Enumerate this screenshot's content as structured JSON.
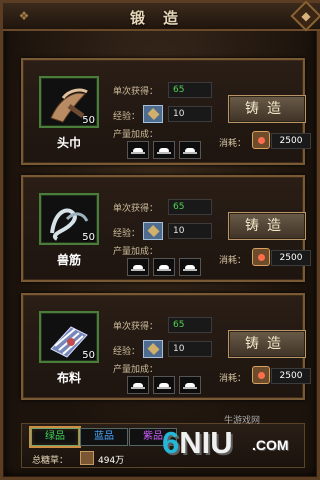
{
  "header": {
    "title": "锻造",
    "close_icon": "close-icon"
  },
  "items": [
    {
      "name": "头巾",
      "level": "50",
      "yield_label": "单次获得：",
      "yield_value": "65",
      "exp_label": "经验：",
      "exp_value": "10",
      "bonus_label": "产量加成：",
      "button_label": "铸造",
      "cost_label": "消耗：",
      "cost_value": "2500",
      "icon": "headscarf-icon"
    },
    {
      "name": "兽筋",
      "level": "50",
      "yield_label": "单次获得：",
      "yield_value": "65",
      "exp_label": "经验：",
      "exp_value": "10",
      "bonus_label": "产量加成：",
      "button_label": "铸造",
      "cost_label": "消耗：",
      "cost_value": "2500",
      "icon": "tendon-icon"
    },
    {
      "name": "布料",
      "level": "50",
      "yield_label": "单次获得：",
      "yield_value": "65",
      "exp_label": "经验：",
      "exp_value": "10",
      "bonus_label": "产量加成：",
      "button_label": "铸造",
      "cost_label": "消耗：",
      "cost_value": "2500",
      "icon": "cloth-icon"
    }
  ],
  "footer": {
    "tabs": [
      {
        "label": "绿品",
        "color": "#42d35a"
      },
      {
        "label": "蓝品",
        "color": "#4aa8ff"
      },
      {
        "label": "紫品",
        "color": "#d05fff"
      }
    ],
    "total_label": "总糖草：",
    "total_value": "494万"
  },
  "watermark": {
    "text_6": "6",
    "text_niu": "NIU",
    "domain": ".COM",
    "cn": "牛游戏网"
  }
}
